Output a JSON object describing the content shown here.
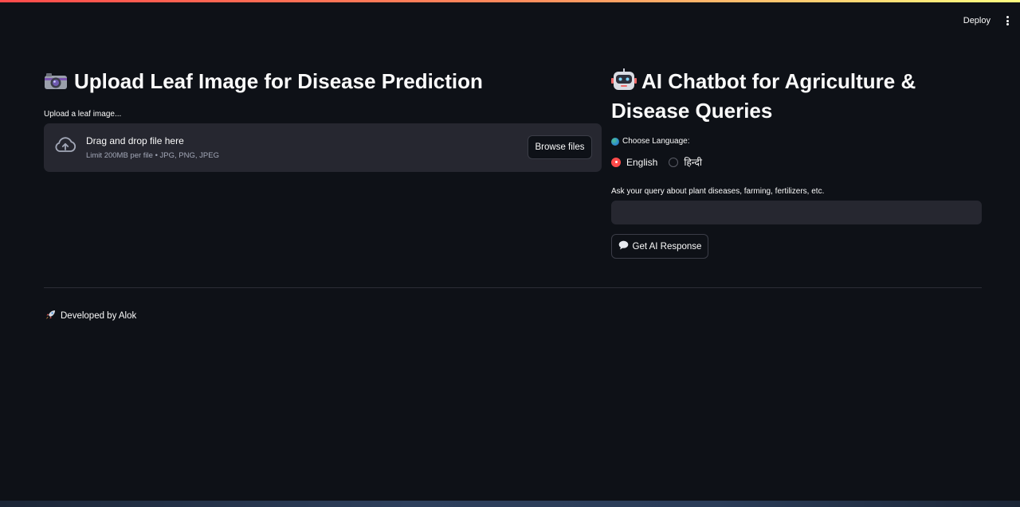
{
  "header": {
    "deploy_label": "Deploy"
  },
  "left": {
    "title": "Upload Leaf Image for Disease Prediction",
    "upload_label": "Upload a leaf image...",
    "dropzone_title": "Drag and drop file here",
    "dropzone_hint": "Limit 200MB per file • JPG, PNG, JPEG",
    "browse_label": "Browse files"
  },
  "right": {
    "title": "AI Chatbot for Agriculture & Disease Queries",
    "language_label": "Choose Language:",
    "languages": [
      {
        "label": "English",
        "selected": true
      },
      {
        "label": "हिन्दी",
        "selected": false
      }
    ],
    "query_label": "Ask your query about plant diseases, farming, fertilizers, etc.",
    "query_value": "",
    "button_label": "Get AI Response"
  },
  "footer": {
    "text": "Developed by Alok"
  },
  "colors": {
    "background": "#0e1117",
    "panel": "#262730",
    "accent": "#ff4b4b"
  }
}
